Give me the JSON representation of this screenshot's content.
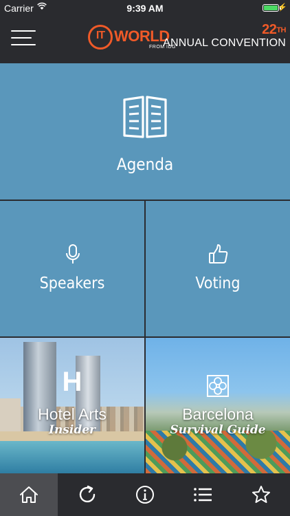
{
  "status_bar": {
    "carrier": "Carrier",
    "time": "9:39 AM"
  },
  "header": {
    "logo_text": "IT",
    "logo_world": "WORLD",
    "logo_sub": "FROM IDG",
    "convention_number": "22",
    "convention_suffix": "TH",
    "convention_text": "ANNUAL CONVENTION",
    "accent_color": "#f05a28"
  },
  "tiles": {
    "agenda": {
      "label": "Agenda",
      "icon": "book-icon"
    },
    "speakers": {
      "label": "Speakers",
      "icon": "microphone-icon"
    },
    "voting": {
      "label": "Voting",
      "icon": "thumbs-up-icon"
    },
    "hotel": {
      "badge": "H",
      "title": "Hotel Arts",
      "subtitle": "Insider"
    },
    "barcelona": {
      "title": "Barcelona",
      "subtitle": "Survival Guide",
      "icon": "tile-ornament-icon"
    },
    "tile_color": "#5a97bb"
  },
  "tabbar": {
    "items": [
      {
        "icon": "home-icon",
        "active": true
      },
      {
        "icon": "refresh-icon",
        "active": false
      },
      {
        "icon": "info-icon",
        "active": false
      },
      {
        "icon": "list-icon",
        "active": false
      },
      {
        "icon": "star-icon",
        "active": false
      }
    ]
  }
}
